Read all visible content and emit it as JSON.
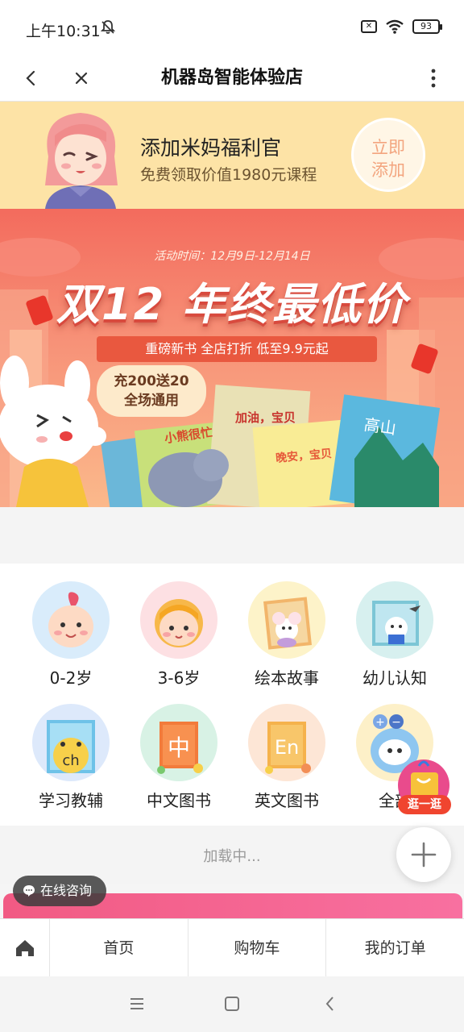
{
  "status_bar": {
    "time": "上午10:31",
    "battery": "93"
  },
  "title_bar": {
    "title": "机器岛智能体验店"
  },
  "promo": {
    "title": "添加米妈福利官",
    "subtitle": "免费领取价值1980元课程",
    "button_label": "立即\n添加"
  },
  "banner": {
    "activity_time": "活动时间：12月9日-12月14日",
    "headline": "双12 年终最低价",
    "subline": "重磅新书  全店打折  低至9.9元起",
    "bubble": "充200送20\n全场通用",
    "book_titles": [
      "小熊很忙",
      "加油，宝贝",
      "晚安，宝贝",
      "高山"
    ]
  },
  "categories": [
    {
      "label": "0-2岁",
      "icon": "baby-icon",
      "bg": "#d9ecfb"
    },
    {
      "label": "3-6岁",
      "icon": "girl-icon",
      "bg": "#fde0e3"
    },
    {
      "label": "绘本故事",
      "icon": "picture-book-icon",
      "bg": "#fdf3c9"
    },
    {
      "label": "幼儿认知",
      "icon": "cognition-book-icon",
      "bg": "#d7f0ef"
    },
    {
      "label": "学习教辅",
      "icon": "study-book-icon",
      "bg": "#dde9fb"
    },
    {
      "label": "中文图书",
      "icon": "chinese-book-icon",
      "bg": "#d8f2e5"
    },
    {
      "label": "英文图书",
      "icon": "english-book-icon",
      "bg": "#fde6d6"
    },
    {
      "label": "全部",
      "icon": "robot-icon",
      "bg": "#fdf0c8"
    }
  ],
  "category_glyphs": {
    "chinese": "中",
    "english": "En",
    "study": "ch"
  },
  "loading": {
    "text": "加载中..."
  },
  "floating": {
    "shop_label": "逛一逛",
    "consult_label": "在线咨询"
  },
  "tab_bar": {
    "tabs": [
      "首页",
      "购物车",
      "我的订单"
    ]
  },
  "colors": {
    "accent": "#f0452f",
    "promo_bg": "#fde3a6",
    "banner_top": "#f36b5d"
  }
}
